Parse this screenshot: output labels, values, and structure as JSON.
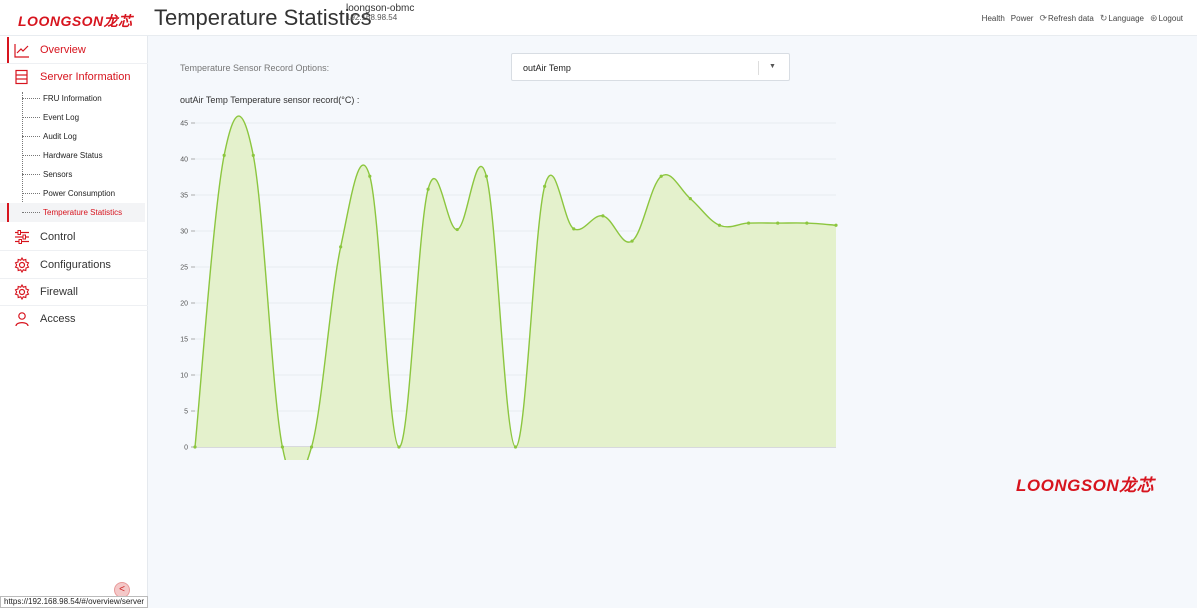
{
  "header": {
    "logo_text": "LOONGSON龙芯",
    "title": "Temperature Statistics",
    "host_name": "loongson-obmc",
    "host_ip": "192.168.98.54",
    "nav": {
      "health": "Health",
      "power": "Power",
      "refresh": "Refresh data",
      "language": "Language",
      "logout": "Logout"
    }
  },
  "sidebar": {
    "overview": "Overview",
    "server_information": "Server Information",
    "sub_items": [
      "FRU Information",
      "Event Log",
      "Audit Log",
      "Hardware Status",
      "Sensors",
      "Power Consumption",
      "Temperature Statistics"
    ],
    "control": "Control",
    "configurations": "Configurations",
    "firewall": "Firewall",
    "access": "Access",
    "collapse_icon": "chevron-left-icon"
  },
  "main": {
    "record_options_label": "Temperature Sensor Record Options:",
    "selected_sensor": "outAir Temp",
    "chart_heading": "outAir Temp Temperature sensor record(°C) :"
  },
  "statusbar_url": "https://192.168.98.54/#/overview/server",
  "brand_logo_text": "LOONGSON龙芯",
  "colors": {
    "accent": "#d7141e",
    "series_line": "#8cc63f",
    "series_fill": "#e4f1cc"
  },
  "chart_data": {
    "type": "area",
    "title": "outAir Temp Temperature sensor record(°C) :",
    "xlabel": "",
    "ylabel": "",
    "ylim": [
      0,
      45
    ],
    "yticks": [
      0,
      5,
      10,
      15,
      20,
      25,
      30,
      35,
      40,
      45
    ],
    "grid": true,
    "legend": "none",
    "series": [
      {
        "values": [
          0,
          40.5,
          40.5,
          0,
          0,
          27.8,
          37.6,
          0,
          35.8,
          30.2,
          37.6,
          0,
          36.2,
          30.3,
          32.1,
          28.6,
          37.6,
          34.5,
          30.8,
          31.1,
          31.1,
          31.1,
          30.8
        ]
      }
    ],
    "x": [
      0,
      1,
      2,
      3,
      4,
      5,
      6,
      7,
      8,
      9,
      10,
      11,
      12,
      13,
      14,
      15,
      16,
      17,
      18,
      19,
      20,
      21,
      22
    ]
  }
}
